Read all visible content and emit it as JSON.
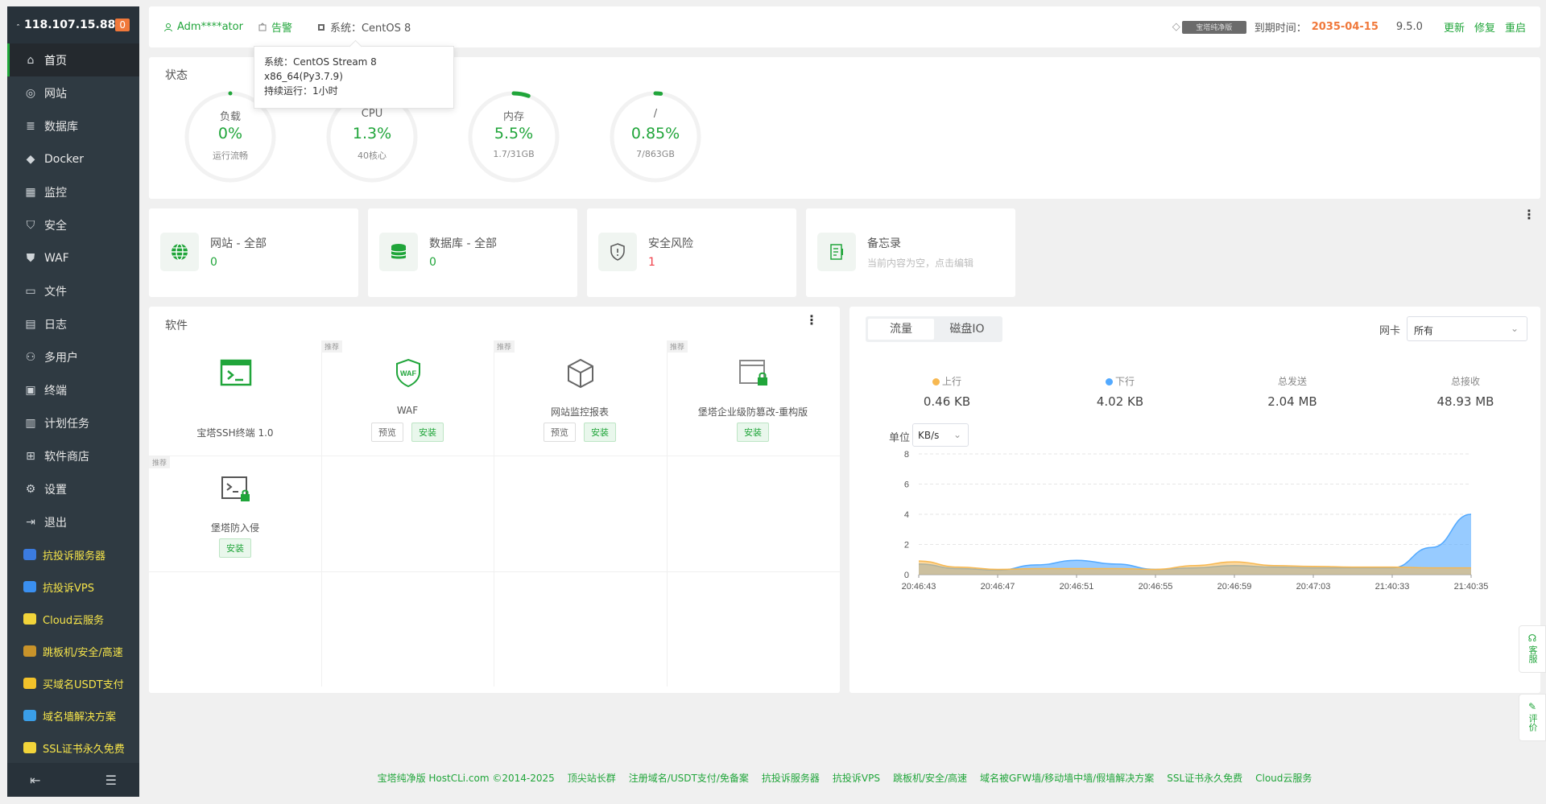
{
  "sidebar": {
    "ip": "118.107.15.88",
    "badge": "0",
    "items": [
      {
        "label": "首页",
        "icon": "home-icon"
      },
      {
        "label": "网站",
        "icon": "globe-icon"
      },
      {
        "label": "数据库",
        "icon": "database-icon"
      },
      {
        "label": "Docker",
        "icon": "docker-icon"
      },
      {
        "label": "监控",
        "icon": "monitor-icon"
      },
      {
        "label": "安全",
        "icon": "shield-icon"
      },
      {
        "label": "WAF",
        "icon": "waf-icon"
      },
      {
        "label": "文件",
        "icon": "folder-icon"
      },
      {
        "label": "日志",
        "icon": "log-icon"
      },
      {
        "label": "多用户",
        "icon": "users-icon"
      },
      {
        "label": "终端",
        "icon": "terminal-icon"
      },
      {
        "label": "计划任务",
        "icon": "calendar-icon"
      },
      {
        "label": "软件商店",
        "icon": "apps-icon"
      },
      {
        "label": "设置",
        "icon": "gear-icon"
      },
      {
        "label": "退出",
        "icon": "logout-icon"
      }
    ],
    "ads": [
      {
        "label": "抗投诉服务器",
        "color": "#3b7be0"
      },
      {
        "label": "抗投诉VPS",
        "color": "#3a8ff0"
      },
      {
        "label": "Cloud云服务",
        "color": "#f2d43a"
      },
      {
        "label": "跳板机/安全/高速",
        "color": "#c9932a"
      },
      {
        "label": "买域名USDT支付",
        "color": "#f2c22a"
      },
      {
        "label": "域名墙解决方案",
        "color": "#3a9ee8"
      },
      {
        "label": "SSL证书永久免费",
        "color": "#f2d43a"
      }
    ]
  },
  "topbar": {
    "user": "Adm****ator",
    "alert": "告警",
    "system": "系统：CentOS 8",
    "gem_text": "宝塔纯净版",
    "expire_label": "到期时间：",
    "expire_date": "2035-04-15",
    "version": "9.5.0",
    "update": "更新",
    "repair": "修复",
    "restart": "重启"
  },
  "tooltip": {
    "line1": "系统：CentOS Stream 8",
    "line2": "x86_64(Py3.7.9)",
    "line3": "持续运行：1小时"
  },
  "status": {
    "title": "状态",
    "gauges": [
      {
        "label": "负载",
        "value": "0%",
        "sub": "运行流畅",
        "pct": 0
      },
      {
        "label": "CPU",
        "value": "1.3%",
        "sub": "40核心",
        "pct": 1.3
      },
      {
        "label": "内存",
        "value": "5.5%",
        "sub": "1.7/31GB",
        "pct": 5.5
      },
      {
        "label": "/",
        "value": "0.85%",
        "sub": "7/863GB",
        "pct": 0.85
      }
    ]
  },
  "cards": [
    {
      "title": "网站 - 全部",
      "value": "0"
    },
    {
      "title": "数据库 - 全部",
      "value": "0"
    },
    {
      "title": "安全风险",
      "value": "1"
    },
    {
      "title": "备忘录",
      "value": "当前内容为空，点击编辑"
    }
  ],
  "software": {
    "title": "软件",
    "tag": "推荐",
    "preview": "预览",
    "install": "安装",
    "items": [
      {
        "name": "宝塔SSH终端 1.0"
      },
      {
        "name": "WAF"
      },
      {
        "name": "网站监控报表"
      },
      {
        "name": "堡塔企业级防篡改-重构版"
      },
      {
        "name": "堡塔防入侵"
      }
    ]
  },
  "traffic": {
    "tabs": [
      "流量",
      "磁盘IO"
    ],
    "nic_label": "网卡",
    "nic_value": "所有",
    "stats": [
      {
        "label": "上行",
        "value": "0.46 KB",
        "color": "#f7b851"
      },
      {
        "label": "下行",
        "value": "4.02 KB",
        "color": "#52a9ff"
      },
      {
        "label": "总发送",
        "value": "2.04 MB"
      },
      {
        "label": "总接收",
        "value": "48.93 MB"
      }
    ],
    "unit_label": "单位",
    "unit_value": "KB/s"
  },
  "chart_data": {
    "type": "area",
    "x": [
      "20:46:43",
      "20:46:45",
      "20:46:47",
      "20:46:49",
      "20:46:51",
      "20:46:53",
      "20:46:55",
      "20:46:57",
      "20:46:59",
      "20:47:01",
      "20:47:03",
      "20:47:05",
      "21:40:33",
      "21:40:34",
      "21:40:35"
    ],
    "xticks": [
      "20:46:43",
      "20:46:47",
      "20:46:51",
      "20:46:55",
      "20:46:59",
      "20:47:03",
      "21:40:33",
      "21:40:35"
    ],
    "yticks": [
      "0",
      "2",
      "4",
      "6",
      "8"
    ],
    "ylim": [
      0,
      8
    ],
    "series": [
      {
        "name": "上行",
        "color": "#f7b851",
        "values": [
          0.9,
          0.5,
          0.35,
          0.4,
          0.4,
          0.4,
          0.35,
          0.6,
          0.85,
          0.6,
          0.55,
          0.5,
          0.5,
          0.45,
          0.45
        ]
      },
      {
        "name": "下行",
        "color": "#52a9ff",
        "values": [
          0.7,
          0.4,
          0.3,
          0.65,
          0.95,
          0.7,
          0.35,
          0.45,
          0.6,
          0.5,
          0.45,
          0.45,
          0.45,
          1.8,
          4.0
        ]
      }
    ]
  },
  "footer": [
    "宝塔纯净版 HostCLi.com ©2014-2025",
    "顶尖站长群",
    "注册域名/USDT支付/免备案",
    "抗投诉服务器",
    "抗投诉VPS",
    "跳板机/安全/高速",
    "域名被GFW墙/移动墙中墙/假墙解决方案",
    "SSL证书永久免费",
    "Cloud云服务"
  ],
  "float": {
    "service": "客服",
    "review": "评价"
  }
}
